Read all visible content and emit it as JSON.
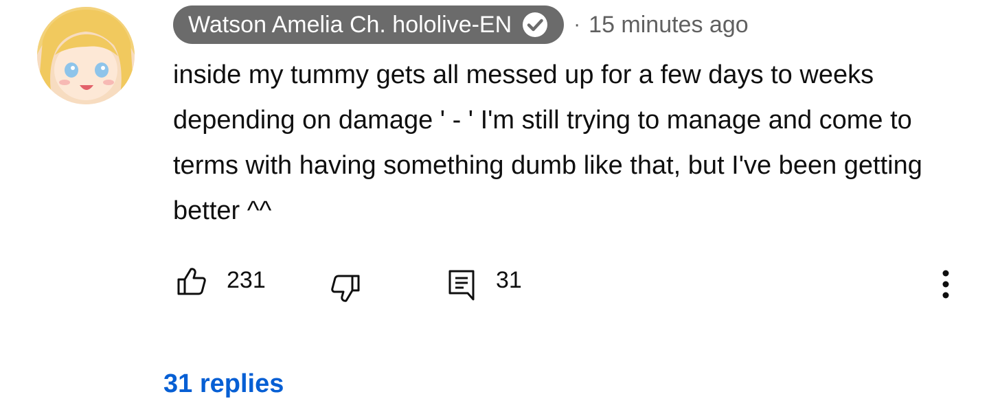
{
  "comment": {
    "author": "Watson Amelia Ch. hololive-EN",
    "verified_icon": "verified-check-icon",
    "separator": "·",
    "timestamp": "15 minutes ago",
    "text": "inside my tummy gets all messed up for a few days to weeks depending on damage ' - ' I'm still trying to manage and come to terms with having something dumb like that, but I've been getting better ^^",
    "avatar_icon": "avatar-anime-blonde"
  },
  "actions": {
    "like_icon": "thumbs-up-icon",
    "like_count": "231",
    "dislike_icon": "thumbs-down-icon",
    "reply_icon": "comment-reply-icon",
    "reply_count": "31",
    "more_icon": "more-vertical-icon"
  },
  "replies": {
    "label": "31 replies"
  },
  "colors": {
    "author_chip_bg": "#6b6b6b",
    "secondary_text": "#606060",
    "link_blue": "#065fd4",
    "primary_text": "#0f0f0f"
  }
}
